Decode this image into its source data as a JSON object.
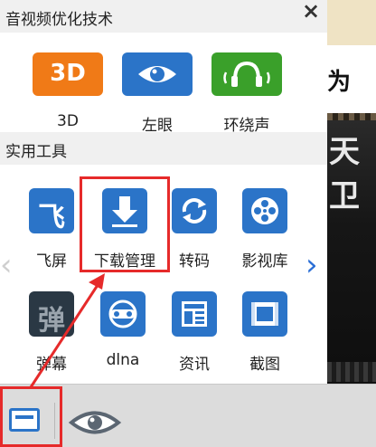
{
  "colors": {
    "blue": "#2b74c8",
    "orange": "#f07a17",
    "green": "#3aa02a",
    "gray_tile": "#2a3844",
    "highlight": "#e62a2a"
  },
  "panel": {
    "section_optimize": "音视频优化技术",
    "section_tools": "实用工具",
    "close_icon": "close-icon"
  },
  "optimize_items": [
    {
      "label": "3D",
      "icon": "3d-icon",
      "icon_text": "3D"
    },
    {
      "label": "左眼",
      "icon": "eye-icon"
    },
    {
      "label": "环绕声",
      "icon": "headphones-icon"
    }
  ],
  "tools": [
    {
      "label": "飞屏",
      "icon": "fly-screen-icon",
      "icon_text": "飞"
    },
    {
      "label": "下载管理",
      "icon": "download-icon"
    },
    {
      "label": "转码",
      "icon": "transcode-icon"
    },
    {
      "label": "影视库",
      "icon": "film-reel-icon"
    },
    {
      "label": "弹幕",
      "icon": "danmaku-icon",
      "icon_text": "弹"
    },
    {
      "label": "dlna",
      "icon": "dlna-icon"
    },
    {
      "label": "资讯",
      "icon": "news-icon"
    },
    {
      "label": "截图",
      "icon": "screenshot-icon"
    }
  ],
  "nav": {
    "prev": "‹",
    "next": "›"
  },
  "background": {
    "band_text": "为",
    "video_text": "天卫"
  }
}
